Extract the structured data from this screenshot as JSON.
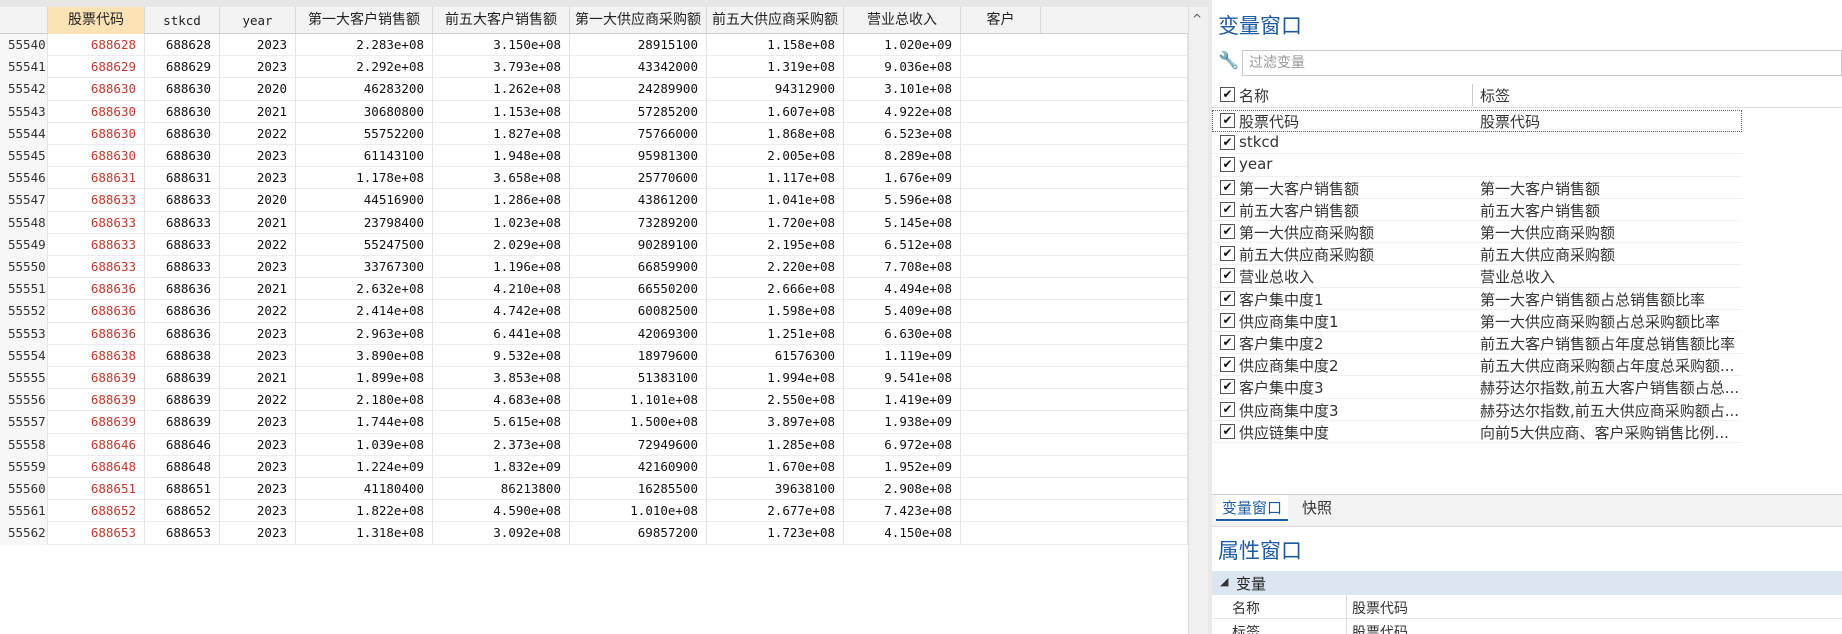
{
  "grid": {
    "columns": [
      {
        "label": "",
        "key": "obs"
      },
      {
        "label": "股票代码",
        "key": "code"
      },
      {
        "label": "stkcd",
        "key": "stkcd"
      },
      {
        "label": "year",
        "key": "year"
      },
      {
        "label": "第一大客户销售额",
        "key": "c1"
      },
      {
        "label": "前五大客户销售额",
        "key": "c5"
      },
      {
        "label": "第一大供应商采购额",
        "key": "s1"
      },
      {
        "label": "前五大供应商采购额",
        "key": "s5"
      },
      {
        "label": "营业总收入",
        "key": "rev"
      },
      {
        "label": "客户",
        "key": "more"
      }
    ],
    "rows": [
      [
        "55540",
        "688628",
        "688628",
        "2023",
        "2.283e+08",
        "3.150e+08",
        "28915100",
        "1.158e+08",
        "1.020e+09"
      ],
      [
        "55541",
        "688629",
        "688629",
        "2023",
        "2.292e+08",
        "3.793e+08",
        "43342000",
        "1.319e+08",
        "9.036e+08"
      ],
      [
        "55542",
        "688630",
        "688630",
        "2020",
        "46283200",
        "1.262e+08",
        "24289900",
        "94312900",
        "3.101e+08"
      ],
      [
        "55543",
        "688630",
        "688630",
        "2021",
        "30680800",
        "1.153e+08",
        "57285200",
        "1.607e+08",
        "4.922e+08"
      ],
      [
        "55544",
        "688630",
        "688630",
        "2022",
        "55752200",
        "1.827e+08",
        "75766000",
        "1.868e+08",
        "6.523e+08"
      ],
      [
        "55545",
        "688630",
        "688630",
        "2023",
        "61143100",
        "1.948e+08",
        "95981300",
        "2.005e+08",
        "8.289e+08"
      ],
      [
        "55546",
        "688631",
        "688631",
        "2023",
        "1.178e+08",
        "3.658e+08",
        "25770600",
        "1.117e+08",
        "1.676e+09"
      ],
      [
        "55547",
        "688633",
        "688633",
        "2020",
        "44516900",
        "1.286e+08",
        "43861200",
        "1.041e+08",
        "5.596e+08"
      ],
      [
        "55548",
        "688633",
        "688633",
        "2021",
        "23798400",
        "1.023e+08",
        "73289200",
        "1.720e+08",
        "5.145e+08"
      ],
      [
        "55549",
        "688633",
        "688633",
        "2022",
        "55247500",
        "2.029e+08",
        "90289100",
        "2.195e+08",
        "6.512e+08"
      ],
      [
        "55550",
        "688633",
        "688633",
        "2023",
        "33767300",
        "1.196e+08",
        "66859900",
        "2.220e+08",
        "7.708e+08"
      ],
      [
        "55551",
        "688636",
        "688636",
        "2021",
        "2.632e+08",
        "4.210e+08",
        "66550200",
        "2.666e+08",
        "4.494e+08"
      ],
      [
        "55552",
        "688636",
        "688636",
        "2022",
        "2.414e+08",
        "4.742e+08",
        "60082500",
        "1.598e+08",
        "5.409e+08"
      ],
      [
        "55553",
        "688636",
        "688636",
        "2023",
        "2.963e+08",
        "6.441e+08",
        "42069300",
        "1.251e+08",
        "6.630e+08"
      ],
      [
        "55554",
        "688638",
        "688638",
        "2023",
        "3.890e+08",
        "9.532e+08",
        "18979600",
        "61576300",
        "1.119e+09"
      ],
      [
        "55555",
        "688639",
        "688639",
        "2021",
        "1.899e+08",
        "3.853e+08",
        "51383100",
        "1.994e+08",
        "9.541e+08"
      ],
      [
        "55556",
        "688639",
        "688639",
        "2022",
        "2.180e+08",
        "4.683e+08",
        "1.101e+08",
        "2.550e+08",
        "1.419e+09"
      ],
      [
        "55557",
        "688639",
        "688639",
        "2023",
        "1.744e+08",
        "5.615e+08",
        "1.500e+08",
        "3.897e+08",
        "1.938e+09"
      ],
      [
        "55558",
        "688646",
        "688646",
        "2023",
        "1.039e+08",
        "2.373e+08",
        "72949600",
        "1.285e+08",
        "6.972e+08"
      ],
      [
        "55559",
        "688648",
        "688648",
        "2023",
        "1.224e+09",
        "1.832e+09",
        "42160900",
        "1.670e+08",
        "1.952e+09"
      ],
      [
        "55560",
        "688651",
        "688651",
        "2023",
        "41180400",
        "86213800",
        "16285500",
        "39638100",
        "2.908e+08"
      ],
      [
        "55561",
        "688652",
        "688652",
        "2023",
        "1.822e+08",
        "4.590e+08",
        "1.010e+08",
        "2.677e+08",
        "7.423e+08"
      ],
      [
        "55562",
        "688653",
        "688653",
        "2023",
        "1.318e+08",
        "3.092e+08",
        "69857200",
        "1.723e+08",
        "4.150e+08"
      ]
    ],
    "scroll_arrow": "^"
  },
  "vars": {
    "title": "变量窗口",
    "filter_placeholder": "过滤变量",
    "header_name": "名称",
    "header_label": "标签",
    "items": [
      {
        "name": "股票代码",
        "label": "股票代码"
      },
      {
        "name": "stkcd",
        "label": ""
      },
      {
        "name": "year",
        "label": ""
      },
      {
        "name": "第一大客户销售额",
        "label": "第一大客户销售额"
      },
      {
        "name": "前五大客户销售额",
        "label": "前五大客户销售额"
      },
      {
        "name": "第一大供应商采购额",
        "label": "第一大供应商采购额"
      },
      {
        "name": "前五大供应商采购额",
        "label": "前五大供应商采购额"
      },
      {
        "name": "营业总收入",
        "label": "营业总收入"
      },
      {
        "name": "客户集中度1",
        "label": "第一大客户销售额占总销售额比率"
      },
      {
        "name": "供应商集中度1",
        "label": "第一大供应商采购额占总采购额比率"
      },
      {
        "name": "客户集中度2",
        "label": "前五大客户销售额占年度总销售额比率"
      },
      {
        "name": "供应商集中度2",
        "label": "前五大供应商采购额占年度总采购额..."
      },
      {
        "name": "客户集中度3",
        "label": "赫芬达尔指数,前五大客户销售额占总..."
      },
      {
        "name": "供应商集中度3",
        "label": "赫芬达尔指数,前五大供应商采购额占..."
      },
      {
        "name": "供应链集中度",
        "label": "向前5大供应商、客户采购销售比例..."
      }
    ],
    "tabs": [
      "变量窗口",
      "快照"
    ]
  },
  "props": {
    "title": "属性窗口",
    "section": "变量",
    "rows": [
      {
        "key": "名称",
        "value": "股票代码"
      },
      {
        "key": "标签",
        "value": "股票代码"
      }
    ]
  },
  "check_glyph": "✔",
  "wrench_glyph": "🔧"
}
